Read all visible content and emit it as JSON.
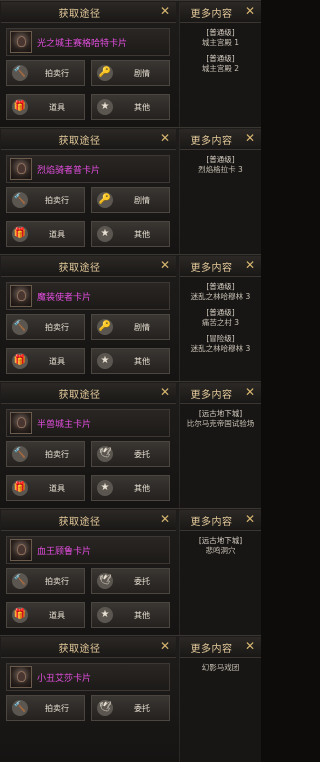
{
  "panel_title": "获取途径",
  "more_title": "更多内容",
  "close_glyph": "✕",
  "panels": [
    {
      "item_name": "光之城主赛格哈特卡片",
      "buttons": [
        {
          "label": "拍卖行",
          "icon": "🔨"
        },
        {
          "label": "剧情",
          "icon": "🔑"
        },
        {
          "label": "道具",
          "icon": "🎁"
        },
        {
          "label": "其他",
          "icon": "★"
        }
      ],
      "sources": [
        {
          "level": "[普通级]",
          "name": "城主宫殿 1"
        },
        {
          "level": "[普通级]",
          "name": "城主宫殿 2"
        }
      ]
    },
    {
      "item_name": "烈焰骑者普卡片",
      "buttons": [
        {
          "label": "拍卖行",
          "icon": "🔨"
        },
        {
          "label": "剧情",
          "icon": "🔑"
        },
        {
          "label": "道具",
          "icon": "🎁"
        },
        {
          "label": "其他",
          "icon": "★"
        }
      ],
      "sources": [
        {
          "level": "[普通级]",
          "name": "烈焰格拉卡 3"
        }
      ]
    },
    {
      "item_name": "魔装使者卡片",
      "buttons": [
        {
          "label": "拍卖行",
          "icon": "🔨"
        },
        {
          "label": "剧情",
          "icon": "🔑"
        },
        {
          "label": "道具",
          "icon": "🎁"
        },
        {
          "label": "其他",
          "icon": "★"
        }
      ],
      "sources": [
        {
          "level": "[普通级]",
          "name": "迷乱之林哈穆林 3"
        },
        {
          "level": "[普通级]",
          "name": "痛苦之村 3"
        },
        {
          "level": "[冒险级]",
          "name": "迷乱之林哈穆林 3"
        }
      ]
    },
    {
      "item_name": "半兽城主卡片",
      "buttons": [
        {
          "label": "拍卖行",
          "icon": "🔨"
        },
        {
          "label": "委托",
          "icon": "🕊"
        },
        {
          "label": "道具",
          "icon": "🎁"
        },
        {
          "label": "其他",
          "icon": "★"
        }
      ],
      "sources": [
        {
          "level": "[远古地下城]",
          "name": "比尔马克帝国试验场"
        }
      ]
    },
    {
      "item_name": "血王顾鲁卡片",
      "buttons": [
        {
          "label": "拍卖行",
          "icon": "🔨"
        },
        {
          "label": "委托",
          "icon": "🕊"
        },
        {
          "label": "道具",
          "icon": "🎁"
        },
        {
          "label": "其他",
          "icon": "★"
        }
      ],
      "sources": [
        {
          "level": "[远古地下城]",
          "name": "悲鸣洞穴"
        }
      ]
    },
    {
      "item_name": "小丑艾莎卡片",
      "buttons": [
        {
          "label": "拍卖行",
          "icon": "🔨"
        },
        {
          "label": "委托",
          "icon": "🕊"
        }
      ],
      "sources": [
        {
          "level": "",
          "name": "幻影马戏团"
        }
      ]
    }
  ]
}
